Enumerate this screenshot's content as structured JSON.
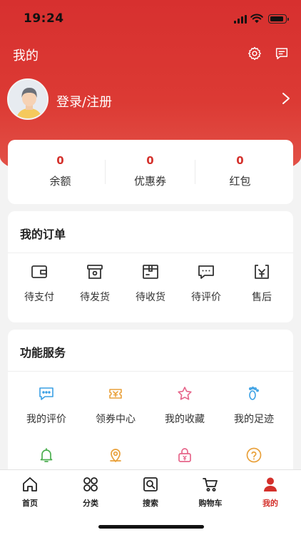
{
  "status_bar": {
    "time": "19:24"
  },
  "header": {
    "title": "我的"
  },
  "profile": {
    "login_label": "登录/注册"
  },
  "wallet": [
    {
      "value": "0",
      "label": "余额"
    },
    {
      "value": "0",
      "label": "优惠券"
    },
    {
      "value": "0",
      "label": "红包"
    }
  ],
  "orders": {
    "title": "我的订单",
    "items": [
      {
        "label": "待支付",
        "icon": "wallet-icon"
      },
      {
        "label": "待发货",
        "icon": "box-icon"
      },
      {
        "label": "待收货",
        "icon": "package-icon"
      },
      {
        "label": "待评价",
        "icon": "comment-icon"
      },
      {
        "label": "售后",
        "icon": "refund-icon"
      }
    ]
  },
  "services": {
    "title": "功能服务",
    "items": [
      {
        "label": "我的评价",
        "icon": "review-icon",
        "color": "#3aa0e4"
      },
      {
        "label": "领券中心",
        "icon": "coupon-icon",
        "color": "#e9a13b"
      },
      {
        "label": "我的收藏",
        "icon": "star-icon",
        "color": "#e6658a"
      },
      {
        "label": "我的足迹",
        "icon": "footprint-icon",
        "color": "#3aa0e4"
      },
      {
        "label": "",
        "icon": "bell-icon",
        "color": "#4caf50"
      },
      {
        "label": "",
        "icon": "location-icon",
        "color": "#e9a13b"
      },
      {
        "label": "",
        "icon": "lock-icon",
        "color": "#e6658a"
      },
      {
        "label": "",
        "icon": "help-icon",
        "color": "#e9a13b"
      }
    ]
  },
  "tabbar": [
    {
      "label": "首页",
      "icon": "home-icon"
    },
    {
      "label": "分类",
      "icon": "category-icon"
    },
    {
      "label": "搜索",
      "icon": "search-icon"
    },
    {
      "label": "购物车",
      "icon": "cart-icon"
    },
    {
      "label": "我的",
      "icon": "user-icon",
      "active": true
    }
  ],
  "colors": {
    "brand_red": "#d7302f",
    "accent_red": "#d4302b"
  }
}
